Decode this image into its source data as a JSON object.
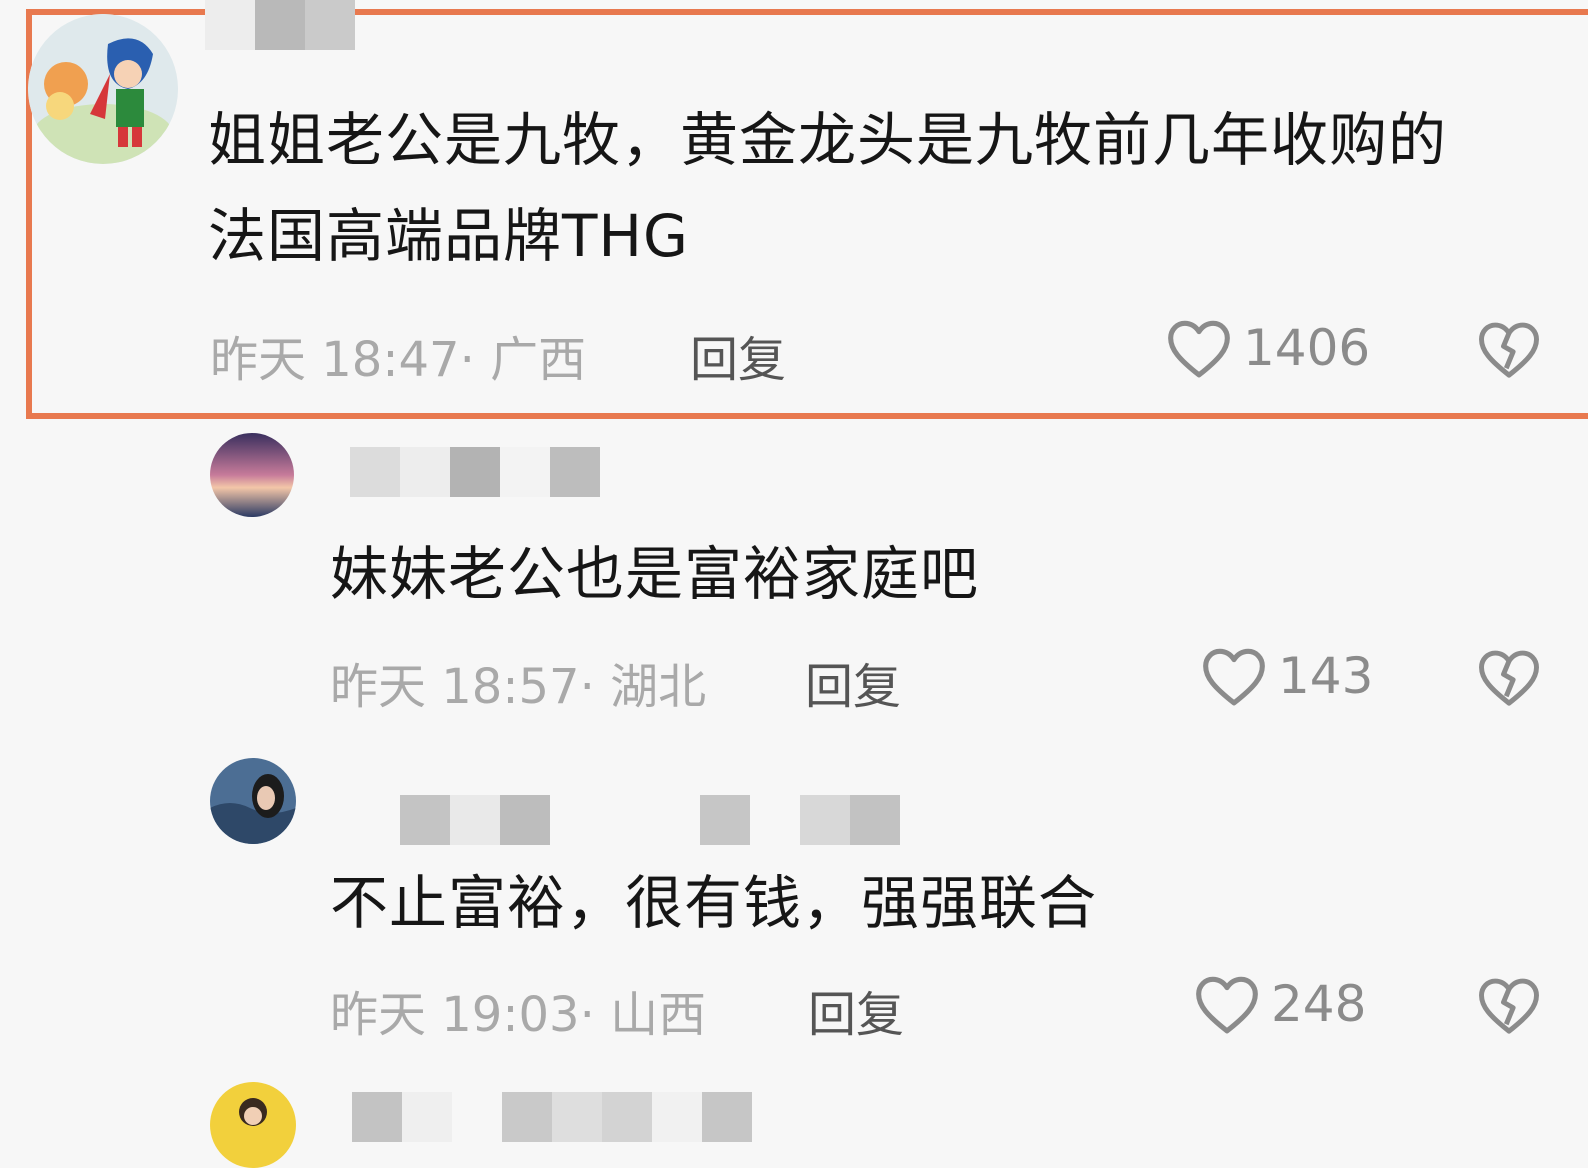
{
  "comments": [
    {
      "text_line1": "姐姐老公是九牧，黄金龙头是九牧前几年收购的",
      "text_line2": "法国高端品牌THG",
      "time": "昨天 18:47",
      "location": "· 广西",
      "reply": "回复",
      "likes": "1406"
    },
    {
      "text": "妹妹老公也是富裕家庭吧",
      "time": "昨天 18:57",
      "location": "· 湖北",
      "reply": "回复",
      "likes": "143"
    },
    {
      "text": "不止富裕，很有钱，强强联合",
      "time": "昨天 19:03",
      "location": "· 山西",
      "reply": "回复",
      "likes": "248"
    }
  ],
  "colors": {
    "highlight": "#e8794f",
    "text": "#161616",
    "meta": "#a9a9a9"
  },
  "icons": {
    "like": "heart-outline-icon",
    "dislike": "broken-heart-icon"
  }
}
